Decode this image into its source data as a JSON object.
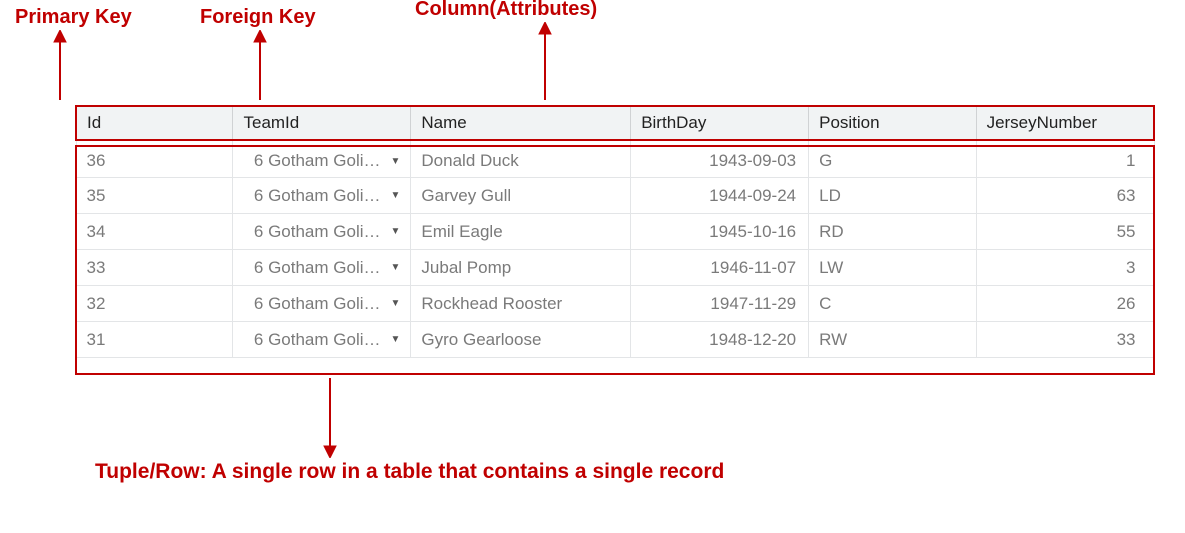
{
  "annotations": {
    "primary_key": "Primary Key",
    "foreign_key": "Foreign Key",
    "column_attributes": "Column(Attributes)",
    "tuple_row": "Tuple/Row: A single row in a table that contains a single record"
  },
  "table": {
    "headers": {
      "id": "Id",
      "teamid": "TeamId",
      "name": "Name",
      "birthday": "BirthDay",
      "position": "Position",
      "jersey": "JerseyNumber"
    },
    "rows": [
      {
        "id": "36",
        "teamid": "6 Gotham Goli…",
        "name": "Donald Duck",
        "birthday": "1943-09-03",
        "position": "G",
        "jersey": "1"
      },
      {
        "id": "35",
        "teamid": "6 Gotham Goli…",
        "name": "Garvey Gull",
        "birthday": "1944-09-24",
        "position": "LD",
        "jersey": "63"
      },
      {
        "id": "34",
        "teamid": "6 Gotham Goli…",
        "name": "Emil Eagle",
        "birthday": "1945-10-16",
        "position": "RD",
        "jersey": "55"
      },
      {
        "id": "33",
        "teamid": "6 Gotham Goli…",
        "name": "Jubal Pomp",
        "birthday": "1946-11-07",
        "position": "LW",
        "jersey": "3"
      },
      {
        "id": "32",
        "teamid": "6 Gotham Goli…",
        "name": "Rockhead Rooster",
        "birthday": "1947-11-29",
        "position": "C",
        "jersey": "26"
      },
      {
        "id": "31",
        "teamid": "6 Gotham Goli…",
        "name": "Gyro Gearloose",
        "birthday": "1948-12-20",
        "position": "RW",
        "jersey": "33"
      }
    ]
  }
}
